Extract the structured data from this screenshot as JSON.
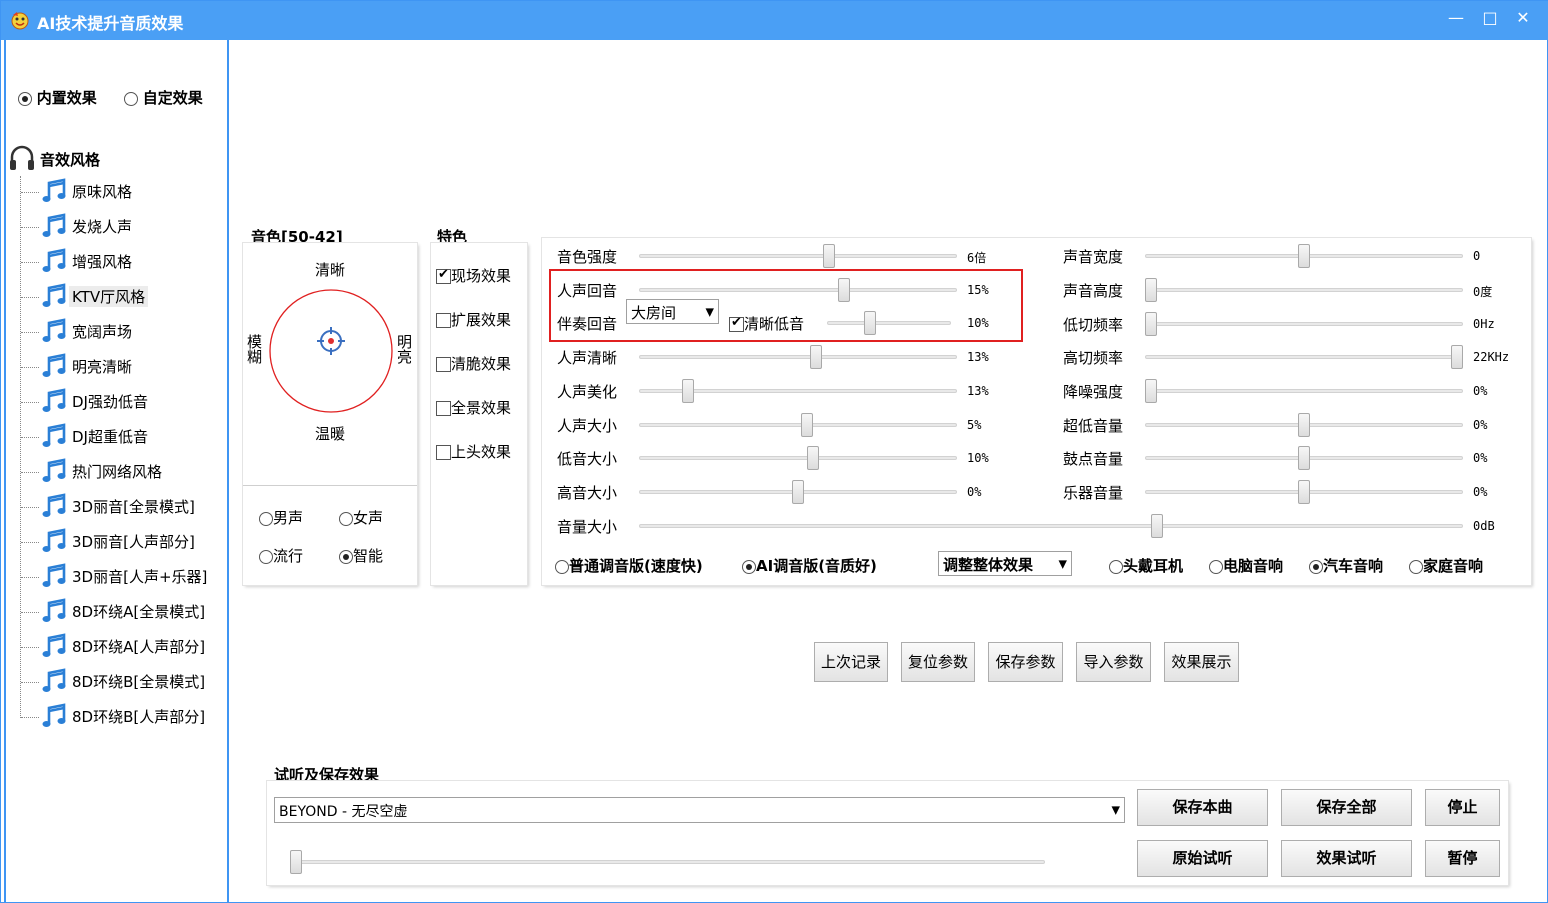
{
  "window": {
    "title": "AI技术提升音质效果",
    "minimize": "—",
    "maximize": "□",
    "close": "✕"
  },
  "mode": {
    "builtin_label": "内置效果",
    "custom_label": "自定效果",
    "selected": "builtin"
  },
  "tree": {
    "root_label": "音效风格",
    "items": [
      {
        "label": "原味风格"
      },
      {
        "label": "发烧人声"
      },
      {
        "label": "增强风格"
      },
      {
        "label": "KTV厅风格"
      },
      {
        "label": "宽阔声场"
      },
      {
        "label": "明亮清晰"
      },
      {
        "label": "DJ强劲低音"
      },
      {
        "label": "DJ超重低音"
      },
      {
        "label": "热门网络风格"
      },
      {
        "label": "3D丽音[全景模式]"
      },
      {
        "label": "3D丽音[人声部分]"
      },
      {
        "label": "3D丽音[人声+乐器]"
      },
      {
        "label": "8D环绕A[全景模式]"
      },
      {
        "label": "8D环绕A[人声部分]"
      },
      {
        "label": "8D环绕B[全景模式]"
      },
      {
        "label": "8D环绕B[人声部分]"
      }
    ],
    "selected_index": 3
  },
  "timbre": {
    "title": "音色[50-42]",
    "top": "清晰",
    "bottom": "温暖",
    "left": "模糊",
    "right": "明亮",
    "voice_options": [
      {
        "label": "男声",
        "checked": false
      },
      {
        "label": "女声",
        "checked": false
      },
      {
        "label": "流行",
        "checked": false
      },
      {
        "label": "智能",
        "checked": true
      }
    ]
  },
  "features": {
    "title": "特色",
    "items": [
      {
        "label": "现场效果",
        "checked": true
      },
      {
        "label": "扩展效果",
        "checked": false
      },
      {
        "label": "清脆效果",
        "checked": false
      },
      {
        "label": "全景效果",
        "checked": false
      },
      {
        "label": "上头效果",
        "checked": false
      }
    ]
  },
  "left_sliders": [
    {
      "label": "音色强度",
      "value": "6倍",
      "pos": 0.6
    },
    {
      "label": "人声回音",
      "value": "15%",
      "pos": 0.65
    },
    {
      "label": "人声清晰",
      "value": "13%",
      "pos": 0.56
    },
    {
      "label": "人声美化",
      "value": "13%",
      "pos": 0.14
    },
    {
      "label": "人声大小",
      "value": "5%",
      "pos": 0.53
    },
    {
      "label": "低音大小",
      "value": "10%",
      "pos": 0.55
    },
    {
      "label": "高音大小",
      "value": "0%",
      "pos": 0.5
    }
  ],
  "accomp_echo": {
    "label": "伴奏回音",
    "room_select": "大房间",
    "bass_clear_label": "清晰低音",
    "bass_clear_checked": true,
    "value": "10%",
    "pos": 0.33
  },
  "right_sliders": [
    {
      "label": "声音宽度",
      "value": "0",
      "pos": 0.5
    },
    {
      "label": "声音高度",
      "value": "0度",
      "pos": 0.0
    },
    {
      "label": "低切频率",
      "value": "0Hz",
      "pos": 0.0
    },
    {
      "label": "高切频率",
      "value": "22KHz",
      "pos": 1.0
    },
    {
      "label": "降噪强度",
      "value": "0%",
      "pos": 0.0
    },
    {
      "label": "超低音量",
      "value": "0%",
      "pos": 0.5
    },
    {
      "label": "鼓点音量",
      "value": "0%",
      "pos": 0.5
    },
    {
      "label": "乐器音量",
      "value": "0%",
      "pos": 0.5
    }
  ],
  "volume": {
    "label": "音量大小",
    "value": "0dB",
    "pos": 0.63
  },
  "engine": {
    "normal_label": "普通调音版(速度快)",
    "ai_label": "AI调音版(音质好)",
    "selected": "ai",
    "overall_select": "调整整体效果"
  },
  "output_device": {
    "options": [
      {
        "label": "头戴耳机",
        "checked": false
      },
      {
        "label": "电脑音响",
        "checked": false
      },
      {
        "label": "汽车音响",
        "checked": true
      },
      {
        "label": "家庭音响",
        "checked": false
      }
    ]
  },
  "param_buttons": {
    "last": "上次记录",
    "reset": "复位参数",
    "save": "保存参数",
    "import": "导入参数",
    "demo": "效果展示"
  },
  "preview": {
    "title": "试听及保存效果",
    "song": "BEYOND - 无尽空虚",
    "progress": 0.0,
    "save_song": "保存本曲",
    "save_all": "保存全部",
    "stop": "停止",
    "original": "原始试听",
    "effect": "效果试听",
    "pause": "暂停"
  },
  "colors": {
    "titlebar": "#4a9ff5",
    "highlight_box": "#e02020",
    "note_icon": "#2a7fd6"
  }
}
